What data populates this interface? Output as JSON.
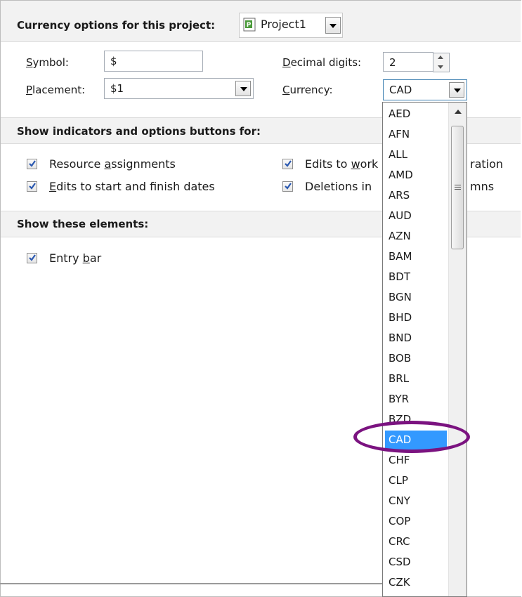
{
  "currency_section": {
    "title": "Currency options for this project:",
    "project_selector": {
      "value": "Project1",
      "icon": "project-file-icon"
    }
  },
  "symbol": {
    "label": "Symbol:",
    "value": "$"
  },
  "placement": {
    "label": "Placement:",
    "value": "$1"
  },
  "decimal_digits": {
    "label": "Decimal digits:",
    "value": "2"
  },
  "currency": {
    "label": "Currency:",
    "value": "CAD"
  },
  "indicators_section": {
    "title": "Show indicators and options buttons for:",
    "checkboxes": [
      {
        "label": "Resource assignments",
        "checked": true
      },
      {
        "label": "Edits to start and finish dates",
        "checked": true
      },
      {
        "label": "Edits to work",
        "visible_suffix": "ration",
        "checked": true
      },
      {
        "label": "Deletions in",
        "visible_suffix": "mns",
        "checked": true
      }
    ]
  },
  "elements_section": {
    "title": "Show these elements:",
    "checkboxes": [
      {
        "label": "Entry bar",
        "checked": true
      }
    ]
  },
  "currency_dropdown": {
    "items": [
      "AED",
      "AFN",
      "ALL",
      "AMD",
      "ARS",
      "AUD",
      "AZN",
      "BAM",
      "BDT",
      "BGN",
      "BHD",
      "BND",
      "BOB",
      "BRL",
      "BYR",
      "BZD",
      "CAD",
      "CHF",
      "CLP",
      "CNY",
      "COP",
      "CRC",
      "CSD",
      "CZK"
    ],
    "selected": "CAD"
  },
  "colors": {
    "selection": "#3399ff",
    "annotation_ring": "#7b1380",
    "header_bg": "#f2f2f2"
  }
}
